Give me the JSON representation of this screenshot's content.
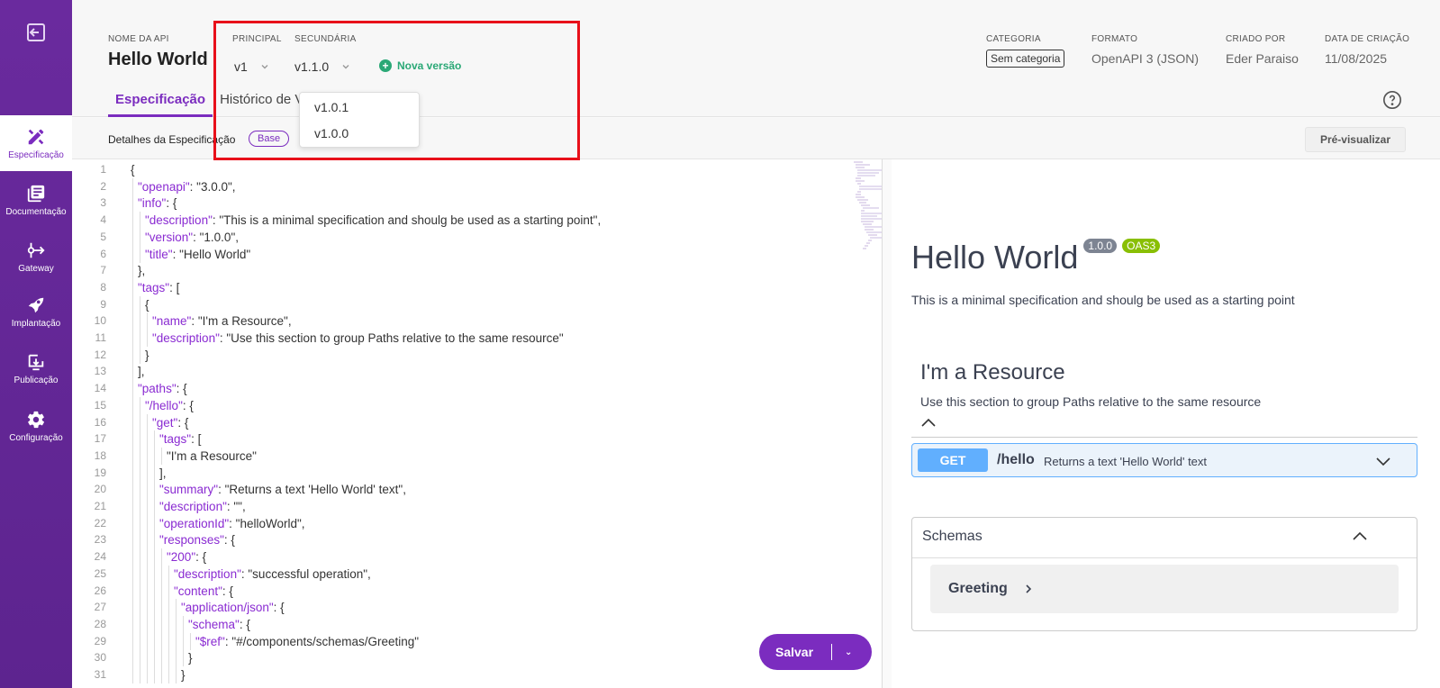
{
  "sidebar": {
    "items": [
      {
        "label": "Especificação",
        "icon": "pencil-ruler-icon",
        "active": true
      },
      {
        "label": "Documentação",
        "icon": "book-icon"
      },
      {
        "label": "Gateway",
        "icon": "gateway-icon"
      },
      {
        "label": "Implantação",
        "icon": "rocket-icon"
      },
      {
        "label": "Publicação",
        "icon": "publish-icon"
      },
      {
        "label": "Configuração",
        "icon": "gear-icon"
      }
    ]
  },
  "header": {
    "api_name_label": "NOME DA API",
    "api_name": "Hello World",
    "principal_label": "PRINCIPAL",
    "principal_value": "v1",
    "secundaria_label": "SECUNDÁRIA",
    "secundaria_value": "v1.1.0",
    "nova_versao": "Nova versão",
    "categoria_label": "CATEGORIA",
    "categoria_value": "Sem categoria",
    "formato_label": "FORMATO",
    "formato_value": "OpenAPI 3 (JSON)",
    "criado_por_label": "CRIADO POR",
    "criado_por_value": "Eder Paraiso",
    "data_label": "DATA DE CRIAÇÃO",
    "data_value": "11/08/2025",
    "tabs": [
      {
        "label": "Especificação",
        "active": true
      },
      {
        "label": "Histórico de Ve"
      }
    ]
  },
  "dropdown": {
    "options": [
      "v1.0.1",
      "v1.0.0"
    ]
  },
  "subheader": {
    "title": "Detalhes da Especificação",
    "badge": "Base",
    "preview_button": "Pré-visualizar"
  },
  "editor": {
    "save_label": "Salvar",
    "line_numbers": [
      "1",
      "2",
      "3",
      "4",
      "5",
      "6",
      "7",
      "8",
      "9",
      "10",
      "11",
      "12",
      "13",
      "14",
      "15",
      "16",
      "17",
      "18",
      "19",
      "20",
      "21",
      "22",
      "23",
      "24",
      "25",
      "26",
      "27",
      "28",
      "29",
      "30",
      "31"
    ]
  },
  "preview": {
    "title": "Hello World",
    "version_badge": "1.0.0",
    "oas_badge": "OAS3",
    "description": "This is a minimal specification and shoulg be used as a starting point",
    "tag_name": "I'm a Resource",
    "tag_description": "Use this section to group Paths relative to the same resource",
    "operation": {
      "method": "GET",
      "path": "/hello",
      "summary": "Returns a text 'Hello World' text"
    },
    "schemas_title": "Schemas",
    "schema_item": "Greeting"
  },
  "colors": {
    "accent": "#7b2cbf",
    "green": "#2aa876",
    "get_blue": "#61affe",
    "oas_green": "#89bf04",
    "highlight_red": "#e8101a"
  }
}
